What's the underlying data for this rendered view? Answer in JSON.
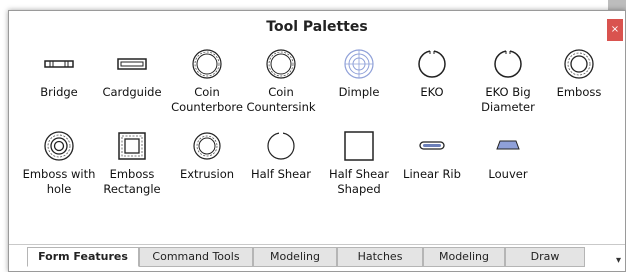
{
  "window": {
    "title": "Tool Palettes",
    "close": "×"
  },
  "tools": [
    {
      "label": "Bridge",
      "icon": "bridge-icon"
    },
    {
      "label": "Cardguide",
      "icon": "cardguide-icon"
    },
    {
      "label": "Coin Counterbore",
      "icon": "coin-counterbore-icon"
    },
    {
      "label": "Coin Countersink",
      "icon": "coin-countersink-icon"
    },
    {
      "label": "Dimple",
      "icon": "dimple-icon"
    },
    {
      "label": "EKO",
      "icon": "eko-icon"
    },
    {
      "label": "EKO Big Diameter",
      "icon": "eko-big-diameter-icon"
    },
    {
      "label": "Emboss",
      "icon": "emboss-icon"
    },
    {
      "label": "Emboss with hole",
      "icon": "emboss-with-hole-icon"
    },
    {
      "label": "Emboss Rectangle",
      "icon": "emboss-rectangle-icon"
    },
    {
      "label": "Extrusion",
      "icon": "extrusion-icon"
    },
    {
      "label": "Half Shear",
      "icon": "half-shear-icon"
    },
    {
      "label": "Half Shear Shaped",
      "icon": "half-shear-shaped-icon"
    },
    {
      "label": "Linear Rib",
      "icon": "linear-rib-icon"
    },
    {
      "label": "Louver",
      "icon": "louver-icon"
    }
  ],
  "tabs": [
    {
      "label": "Form Features",
      "active": true
    },
    {
      "label": "Command Tools",
      "active": false
    },
    {
      "label": "Modeling",
      "active": false
    },
    {
      "label": "Hatches",
      "active": false
    },
    {
      "label": "Modeling",
      "active": false
    },
    {
      "label": "Draw",
      "active": false
    }
  ],
  "overflow": "▾"
}
